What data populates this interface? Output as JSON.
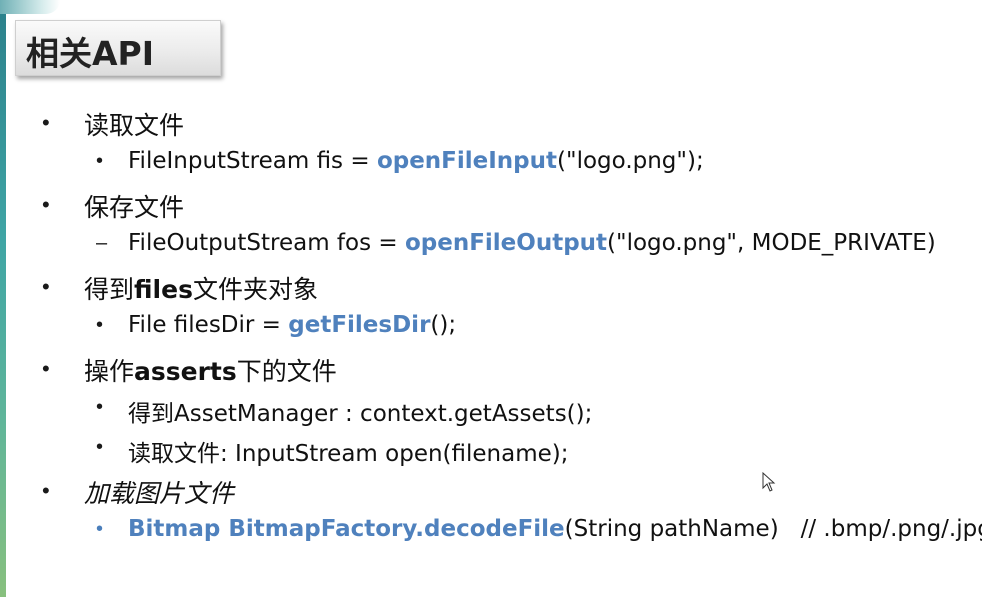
{
  "slide": {
    "title": "相关API",
    "items": [
      {
        "label": "读取文件",
        "sub": [
          {
            "bullet": "•",
            "prefix": "FileInputStream fis = ",
            "method": "openFileInput",
            "suffix": "(\"logo.png\");"
          }
        ]
      },
      {
        "label": "保存文件",
        "sub": [
          {
            "bullet": "–",
            "prefix": "FileOutputStream fos = ",
            "method": "openFileOutput",
            "suffix": "(\"logo.png\", MODE_PRIVATE)"
          }
        ]
      },
      {
        "label_pre": "得到",
        "label_bold": "files",
        "label_post": "文件夹对象",
        "sub": [
          {
            "bullet": "•",
            "prefix": "File filesDir = ",
            "method": "getFilesDir",
            "suffix": "();"
          }
        ]
      },
      {
        "label_pre": "操作",
        "label_bold": "asserts",
        "label_post": "下的文件",
        "sub": [
          {
            "bullet": "•",
            "cn": "得到",
            "text": "AssetManager : context.getAssets();"
          },
          {
            "bullet": "•",
            "cn": "读取文件",
            "text": ": InputStream open(filename);"
          }
        ]
      },
      {
        "label": "加载图片文件",
        "sub": [
          {
            "bullet": "•",
            "method": "Bitmap BitmapFactory.decodeFile",
            "suffix": "(String pathName)   // .bmp/.png/.jpg"
          }
        ]
      }
    ]
  },
  "bullets": {
    "level1": "•"
  },
  "colors": {
    "accent": "#4f81bd",
    "text": "#111111",
    "teal": "#3fa5a5"
  },
  "icons": {
    "cursor": "mouse-pointer-icon"
  }
}
